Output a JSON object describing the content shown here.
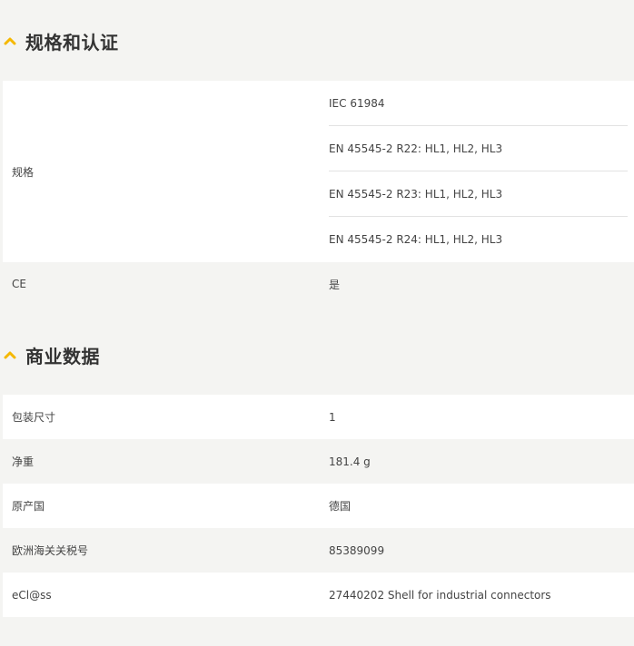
{
  "sections": {
    "specs": {
      "title": "规格和认证",
      "rows": {
        "standards": {
          "label": "规格",
          "values": [
            "IEC 61984",
            "EN 45545-2 R22: HL1, HL2, HL3",
            "EN 45545-2 R23: HL1, HL2, HL3",
            "EN 45545-2 R24: HL1, HL2, HL3"
          ]
        },
        "ce": {
          "label": "CE",
          "value": "是"
        }
      }
    },
    "commercial": {
      "title": "商业数据",
      "rows": [
        {
          "label": "包装尺寸",
          "value": "1"
        },
        {
          "label": "净重",
          "value": "181.4 g"
        },
        {
          "label": "原产国",
          "value": "德国"
        },
        {
          "label": "欧洲海关关税号",
          "value": "85389099"
        },
        {
          "label": "eCl@ss",
          "value": "27440202 Shell for industrial connectors"
        }
      ]
    }
  },
  "colors": {
    "accent": "#f5b800"
  },
  "icons": {
    "section_toggle": "chevron-up-icon"
  }
}
